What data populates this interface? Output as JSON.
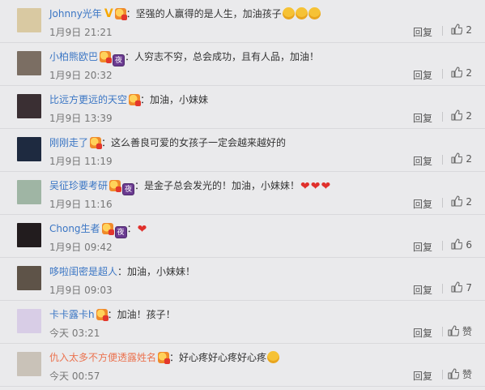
{
  "comments": [
    {
      "username": "Johnny光年",
      "name_color": "blue",
      "badges": [
        "v",
        "heart"
      ],
      "text": "：坚强的人赢得的是人生，加油孩子",
      "emojis": [
        "face",
        "face",
        "face"
      ],
      "time": "1月9日 21:21",
      "reply_label": "回复",
      "likes": "2",
      "avatar_color": "#d9c9a2"
    },
    {
      "username": "小柏熊欧巴",
      "name_color": "blue",
      "badges": [
        "heart",
        "ye"
      ],
      "text": "：人穷志不穷，总会成功，且有人品，加油！",
      "emojis": [],
      "time": "1月9日 20:32",
      "reply_label": "回复",
      "likes": "2",
      "avatar_color": "#7b6e63"
    },
    {
      "username": "比远方更远的天空",
      "name_color": "blue",
      "badges": [
        "heart"
      ],
      "text": "：加油，小妹妹",
      "emojis": [],
      "time": "1月9日 13:39",
      "reply_label": "回复",
      "likes": "2",
      "avatar_color": "#3a2f33"
    },
    {
      "username": "刚刚走了",
      "name_color": "blue",
      "badges": [
        "heart"
      ],
      "text": "：这么善良可爱的女孩子一定会越来越好的",
      "emojis": [],
      "time": "1月9日 11:19",
      "reply_label": "回复",
      "likes": "2",
      "avatar_color": "#1e2a40"
    },
    {
      "username": "吴征珍要考研",
      "name_color": "blue",
      "badges": [
        "heart",
        "ye"
      ],
      "text": "：是金子总会发光的！加油，小妹妹！",
      "emojis": [
        "heart",
        "heart",
        "heart"
      ],
      "time": "1月9日 11:16",
      "reply_label": "回复",
      "likes": "2",
      "avatar_color": "#9fb5a4"
    },
    {
      "username": "Chong生者",
      "name_color": "blue",
      "badges": [
        "heart",
        "ye"
      ],
      "text": "：",
      "emojis": [
        "heart"
      ],
      "time": "1月9日 09:42",
      "reply_label": "回复",
      "likes": "6",
      "avatar_color": "#221c1e"
    },
    {
      "username": "哆啦闺密是超人",
      "name_color": "blue",
      "badges": [],
      "text": "：加油，小妹妹！",
      "emojis": [],
      "time": "1月9日 09:03",
      "reply_label": "回复",
      "likes": "7",
      "avatar_color": "#5e5348"
    },
    {
      "username": "卡卡露卡h",
      "name_color": "blue",
      "badges": [
        "heart"
      ],
      "text": "：加油！孩子！",
      "emojis": [],
      "time": "今天 03:21",
      "reply_label": "回复",
      "likes": "赞",
      "avatar_color": "#d8cde6"
    },
    {
      "username": "仇入太多不方便透露姓名",
      "name_color": "orange",
      "badges": [
        "heart"
      ],
      "text": "：好心疼好心疼好心疼",
      "emojis": [
        "face"
      ],
      "time": "今天 00:57",
      "reply_label": "回复",
      "likes": "赞",
      "avatar_color": "#c9c2b8"
    }
  ],
  "icons": {
    "like": "thumbs-up-icon"
  },
  "colors": {
    "background": "#eaeaec",
    "username_blue": "#3b76c4",
    "username_orange": "#eb7350"
  }
}
